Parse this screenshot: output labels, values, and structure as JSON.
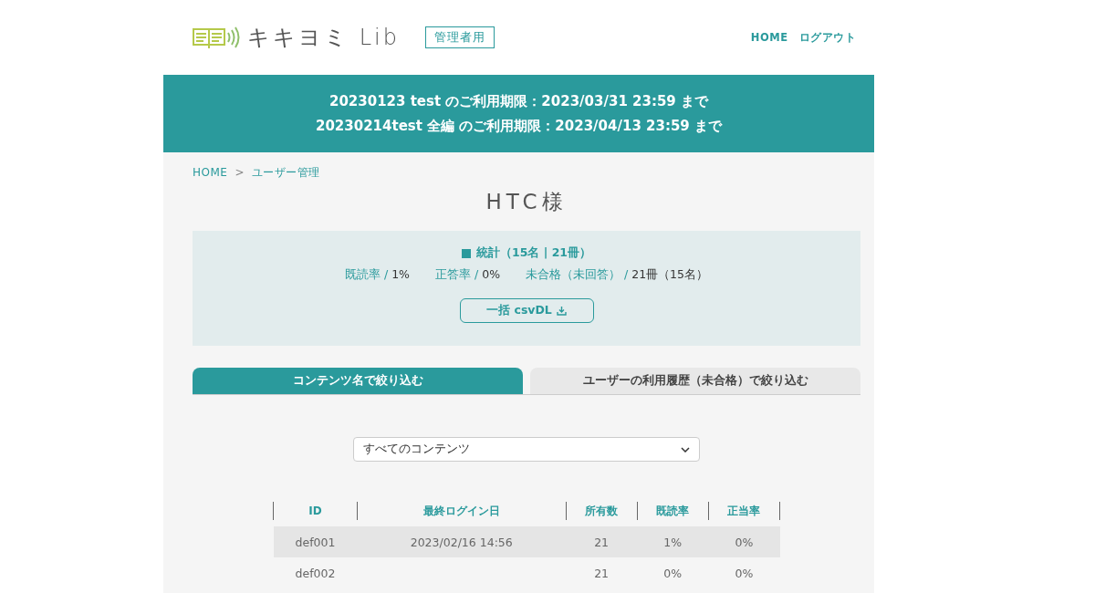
{
  "header": {
    "logo": "キキヨミ Lib",
    "badge": "管理者用",
    "nav": [
      "HOME",
      "ログアウト"
    ]
  },
  "banner": [
    "20230123 test のご利用期限：2023/03/31 23:59 まで",
    "20230214test 全編 のご利用期限：2023/04/13 23:59 まで"
  ],
  "breadcrumb": {
    "items": [
      "HOME",
      "ユーザー管理"
    ],
    "separator": ">"
  },
  "title": "HTC様",
  "stats": {
    "heading": "統計（15名 | 21冊）",
    "metrics": [
      {
        "label": "既読率",
        "value": "1%"
      },
      {
        "label": "正答率",
        "value": "0%"
      },
      {
        "label": "未合格（未回答）",
        "value": "21冊（15名）"
      }
    ],
    "separator": "/",
    "button": "一括 csvDL"
  },
  "tabs": [
    {
      "label": "コンテンツ名で絞り込む",
      "selected": true
    },
    {
      "label": "ユーザーの利用履歴（未合格）で絞り込む",
      "selected": false
    }
  ],
  "filter": {
    "value": "すべてのコンテンツ"
  },
  "table": {
    "columns": [
      "ID",
      "最終ログイン日",
      "所有数",
      "既読率",
      "正当率"
    ],
    "rows": [
      [
        "def001",
        "2023/02/16 14:56",
        "21",
        "1%",
        "0%"
      ],
      [
        "def002",
        "",
        "21",
        "0%",
        "0%"
      ]
    ]
  }
}
